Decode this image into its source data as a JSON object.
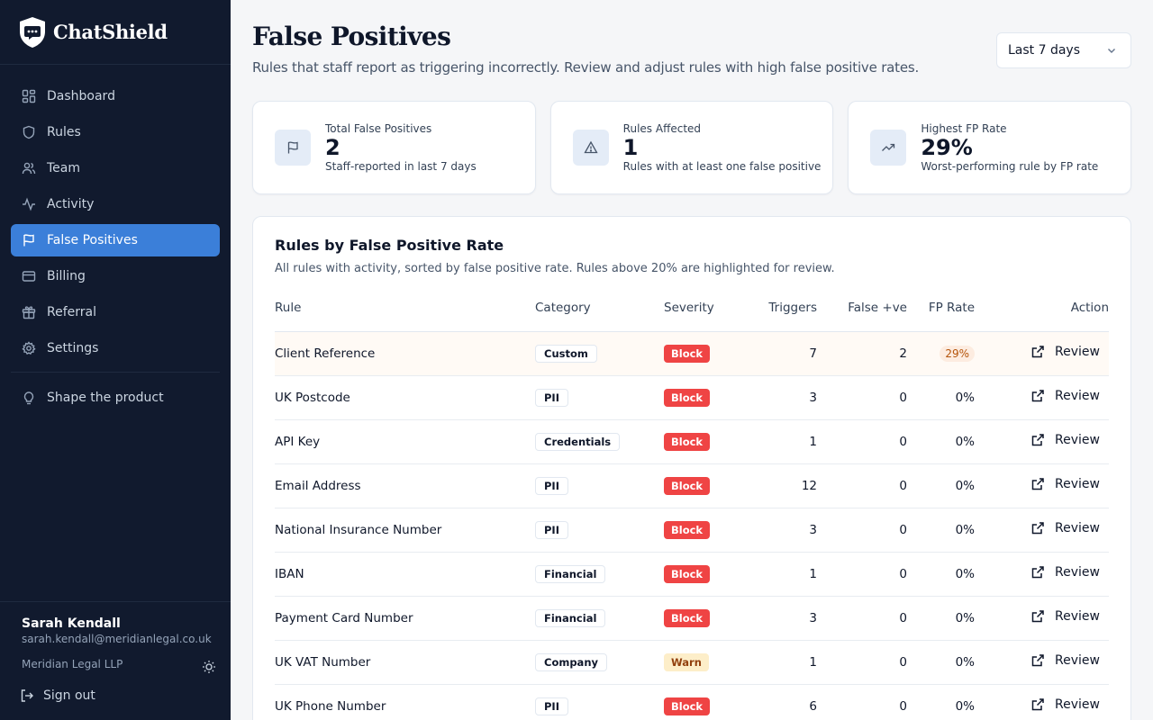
{
  "brand": {
    "name": "ChatShield",
    "icon": "shield-chat-icon"
  },
  "nav": {
    "items": [
      {
        "id": "dashboard",
        "label": "Dashboard",
        "icon": "grid-icon",
        "active": false
      },
      {
        "id": "rules",
        "label": "Rules",
        "icon": "shield-icon",
        "active": false
      },
      {
        "id": "team",
        "label": "Team",
        "icon": "users-icon",
        "active": false
      },
      {
        "id": "activity",
        "label": "Activity",
        "icon": "activity-icon",
        "active": false
      },
      {
        "id": "false-positives",
        "label": "False Positives",
        "icon": "flag-icon",
        "active": true
      },
      {
        "id": "billing",
        "label": "Billing",
        "icon": "credit-card-icon",
        "active": false
      },
      {
        "id": "referral",
        "label": "Referral",
        "icon": "gift-icon",
        "active": false
      },
      {
        "id": "settings",
        "label": "Settings",
        "icon": "gear-icon",
        "active": false
      }
    ],
    "feedback": {
      "label": "Shape the product",
      "icon": "lightbulb-icon"
    }
  },
  "user": {
    "name": "Sarah Kendall",
    "email": "sarah.kendall@meridianlegal.co.uk",
    "org": "Meridian Legal LLP",
    "signout_label": "Sign out"
  },
  "page": {
    "title": "False Positives",
    "subtitle": "Rules that staff report as triggering incorrectly. Review and adjust rules with high false positive rates.",
    "range": "Last 7 days"
  },
  "stats": [
    {
      "label": "Total False Positives",
      "value": "2",
      "desc": "Staff-reported in last 7 days",
      "icon": "flag-icon"
    },
    {
      "label": "Rules Affected",
      "value": "1",
      "desc": "Rules with at least one false positive",
      "icon": "alert-triangle-icon"
    },
    {
      "label": "Highest FP Rate",
      "value": "29%",
      "desc": "Worst-performing rule by FP rate",
      "icon": "trending-up-icon"
    }
  ],
  "table": {
    "title": "Rules by False Positive Rate",
    "subtitle": "All rules with activity, sorted by false positive rate. Rules above 20% are highlighted for review.",
    "columns": [
      "Rule",
      "Category",
      "Severity",
      "Triggers",
      "False +ve",
      "FP Rate",
      "Action"
    ],
    "rows": [
      {
        "rule": "Client Reference",
        "category": "Custom",
        "severity": "Block",
        "triggers": "7",
        "false_pos": "2",
        "fp_rate": "29%",
        "action": "Review",
        "highlight": true
      },
      {
        "rule": "UK Postcode",
        "category": "PII",
        "severity": "Block",
        "triggers": "3",
        "false_pos": "0",
        "fp_rate": "0%",
        "action": "Review"
      },
      {
        "rule": "API Key",
        "category": "Credentials",
        "severity": "Block",
        "triggers": "1",
        "false_pos": "0",
        "fp_rate": "0%",
        "action": "Review"
      },
      {
        "rule": "Email Address",
        "category": "PII",
        "severity": "Block",
        "triggers": "12",
        "false_pos": "0",
        "fp_rate": "0%",
        "action": "Review"
      },
      {
        "rule": "National Insurance Number",
        "category": "PII",
        "severity": "Block",
        "triggers": "3",
        "false_pos": "0",
        "fp_rate": "0%",
        "action": "Review"
      },
      {
        "rule": "IBAN",
        "category": "Financial",
        "severity": "Block",
        "triggers": "1",
        "false_pos": "0",
        "fp_rate": "0%",
        "action": "Review"
      },
      {
        "rule": "Payment Card Number",
        "category": "Financial",
        "severity": "Block",
        "triggers": "3",
        "false_pos": "0",
        "fp_rate": "0%",
        "action": "Review"
      },
      {
        "rule": "UK VAT Number",
        "category": "Company",
        "severity": "Warn",
        "triggers": "1",
        "false_pos": "0",
        "fp_rate": "0%",
        "action": "Review"
      },
      {
        "rule": "UK Phone Number",
        "category": "PII",
        "severity": "Block",
        "triggers": "6",
        "false_pos": "0",
        "fp_rate": "0%",
        "action": "Review"
      }
    ]
  },
  "colors": {
    "sidebar_bg": "#111a2e",
    "active_nav": "#3b7fd9",
    "block": "#ef4444",
    "warn_bg": "#fdeec9",
    "warn_text": "#92400e",
    "fp_pill_bg": "#fdece0",
    "fp_pill_text": "#b45309"
  }
}
